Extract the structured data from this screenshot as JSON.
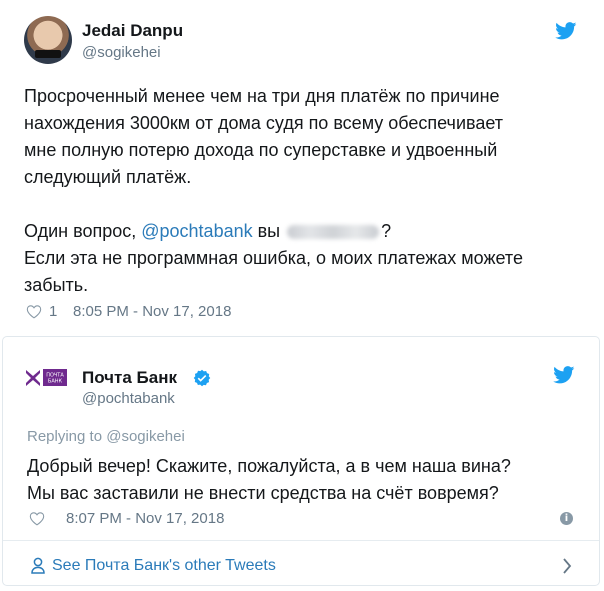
{
  "tweet1": {
    "author_name": "Jedai Danpu",
    "author_handle": "@sogikehei",
    "text_lines": [
      "Просроченный менее чем на три дня платёж по причине",
      "нахождения 3000км от дома судя по всему обеспечивает",
      "мне полную потерю дохода по суперставке и удвоенный",
      "следующий платёж."
    ],
    "question_prefix": "Один вопрос, ",
    "question_mention": "@pochtabank",
    "question_mid": " вы ",
    "question_end": "?",
    "text_last_lines": [
      "Если эта не программная ошибка, о моих платежах можете",
      "забыть."
    ],
    "like_count": "1",
    "timestamp": "8:05 PM - Nov 17, 2018"
  },
  "tweet2": {
    "author_name": "Почта Банк",
    "author_handle": "@pochtabank",
    "logo_text_line1": "ПОЧТА",
    "logo_text_line2": "БАНК",
    "replying_to": "Replying to @sogikehei",
    "text_lines": [
      "Добрый вечер! Скажите, пожалуйста, а в чем наша вина?",
      "Мы вас заставили не внести средства на счёт вовремя?"
    ],
    "timestamp": "8:07 PM - Nov 17, 2018"
  },
  "footer": {
    "link_label": "See Почта Банк's other Tweets"
  },
  "colors": {
    "twitter_blue": "#1da1f2",
    "link": "#2b7bb9",
    "muted": "#657786",
    "brand_purple": "#6f2a8e",
    "brand_red": "#e30613"
  }
}
